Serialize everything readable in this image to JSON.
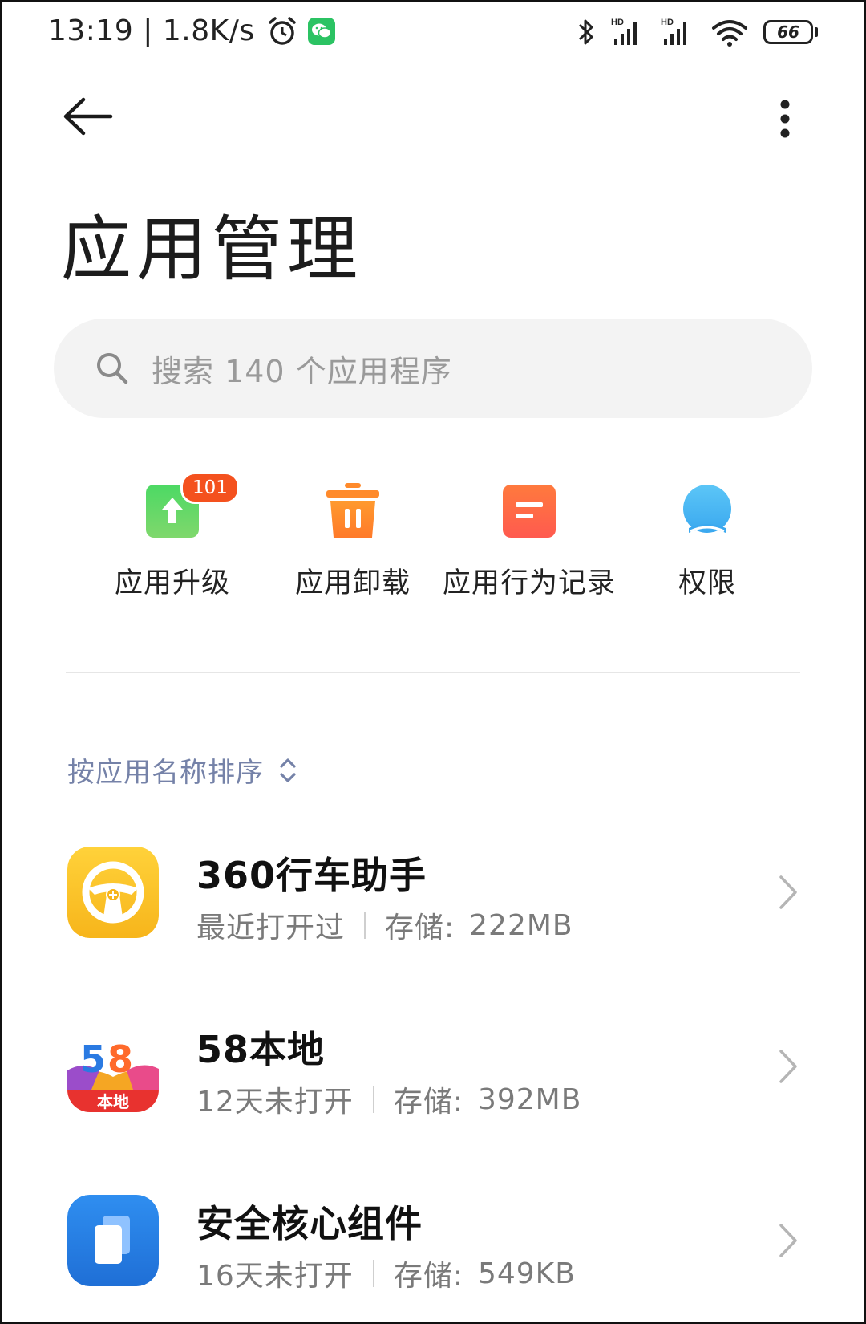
{
  "status_bar": {
    "time": "13:19",
    "separator": "|",
    "net_speed": "1.8K/s",
    "battery": "66",
    "icons": [
      "alarm-icon",
      "wechat-icon",
      "bluetooth-icon",
      "signal-hd-icon",
      "signal-hd-icon",
      "wifi-icon",
      "battery-icon"
    ]
  },
  "header": {
    "back_icon": "arrow-left-icon",
    "more_icon": "more-vertical-icon",
    "title": "应用管理"
  },
  "search": {
    "icon": "search-icon",
    "placeholder": "搜索 140 个应用程序"
  },
  "quick_actions": [
    {
      "label": "应用升级",
      "icon": "upgrade-icon",
      "badge": "101",
      "color": "#5fcf6f"
    },
    {
      "label": "应用卸载",
      "icon": "trash-icon",
      "color": "#ff8a2b"
    },
    {
      "label": "应用行为记录",
      "icon": "record-icon",
      "color": "#ff6a4a"
    },
    {
      "label": "权限",
      "icon": "permission-icon",
      "color": "#4fb8f5"
    }
  ],
  "sort": {
    "label": "按应用名称排序",
    "icon": "sort-toggle-icon"
  },
  "apps": [
    {
      "name": "360行车助手",
      "status": "最近打开过",
      "storage_label": "存储:",
      "storage": "222MB",
      "icon": "steering-wheel-icon"
    },
    {
      "name": "58本地",
      "status": "12天未打开",
      "storage_label": "存储:",
      "storage": "392MB",
      "icon": "app-58-logo-icon",
      "icon_text": "本地"
    },
    {
      "name": "安全核心组件",
      "status": "16天未打开",
      "storage_label": "存储:",
      "storage": "549KB",
      "icon": "security-core-icon"
    }
  ],
  "colors": {
    "accent_sort": "#7582a8",
    "badge": "#f4511e",
    "search_bg": "#f3f3f3"
  }
}
